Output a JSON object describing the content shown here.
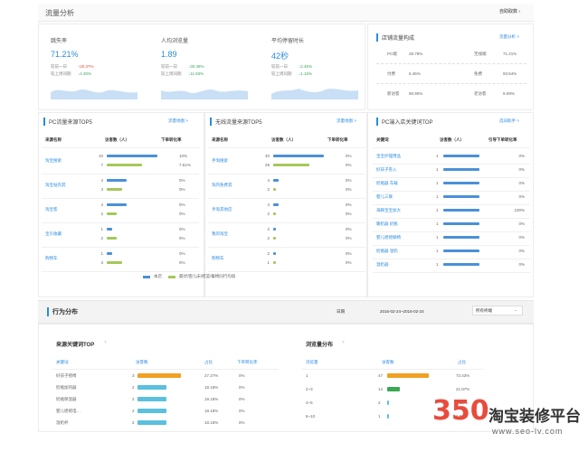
{
  "header": {
    "title": "流量分析",
    "button": "自助取数"
  },
  "metrics": [
    {
      "label": "跳失率",
      "value": "71.21%",
      "cmp1_label": "较前一日",
      "cmp1_val": "↑20.37%",
      "cmp2_label": "较上周同期",
      "cmp2_val": "↓4.30%",
      "c1": "up",
      "c2": "down"
    },
    {
      "label": "人均浏览量",
      "value": "1.89",
      "cmp1_label": "较前一日",
      "cmp1_val": "↓30.48%",
      "cmp2_label": "较上周同期",
      "cmp2_val": "↓11.93%",
      "c1": "down",
      "c2": "down"
    },
    {
      "label": "平均停留时长",
      "value": "42秒",
      "cmp1_label": "较前一日",
      "cmp1_val": "↓2.45%",
      "cmp2_label": "较上周同期",
      "cmp2_val": "↓1.16%",
      "c1": "down",
      "c2": "down"
    }
  ],
  "composition": {
    "title": "店铺流量构成",
    "link": "流量分析 >",
    "rows": [
      {
        "a_label": "PC端",
        "a_val": "28.78%",
        "b_label": "无线端",
        "b_val": "71.21%"
      },
      {
        "a_label": "付费",
        "a_val": "6.45%",
        "b_label": "免费",
        "b_val": "93.54%"
      },
      {
        "a_label": "新访客",
        "a_val": "90.90%",
        "b_label": "老访客",
        "b_val": "9.09%"
      }
    ]
  },
  "pc_source": {
    "title": "PC流量来源TOP5",
    "link": "流量地图 >",
    "headers": [
      "来源名称",
      "访客数（人）",
      "下单转化率"
    ],
    "rows": [
      {
        "name": "淘宝搜索",
        "v1": "10",
        "v2": "7",
        "r1": "10%",
        "r2": "7.51%",
        "b1": 1.0,
        "b2": 0.7
      },
      {
        "name": "淘宝站内其",
        "v1": "4",
        "v2": "3",
        "r1": "0%",
        "r2": "0%",
        "b1": 0.4,
        "b2": 0.3
      },
      {
        "name": "淘宝客",
        "v1": "4",
        "v2": "2",
        "r1": "0%",
        "r2": "0%",
        "b1": 0.4,
        "b2": 0.2
      },
      {
        "name": "宝贝收藏",
        "v1": "1",
        "v2": "2",
        "r1": "0%",
        "r2": "0%",
        "b1": 0.1,
        "b2": 0.2
      },
      {
        "name": "购物车",
        "v1": "1",
        "v2": "3",
        "r1": "0%",
        "r2": "0%",
        "b1": 0.1,
        "b2": 0.3
      }
    ]
  },
  "wireless_source": {
    "title": "无线流量来源TOP5",
    "link": "流量地图 >",
    "headers": [
      "来源名称",
      "访客数（人）",
      "下单转化率"
    ],
    "rows": [
      {
        "name": "手淘搜索",
        "v1": "40",
        "v2": "29",
        "r1": "0%",
        "r2": "0%",
        "b1": 1.0,
        "b2": 0.72
      },
      {
        "name": "淘内免费其",
        "v1": "4",
        "v2": "2",
        "r1": "0%",
        "r2": "0%",
        "b1": 0.1,
        "b2": 0.05
      },
      {
        "name": "手淘其他店",
        "v1": "4",
        "v2": "2",
        "r1": "0%",
        "r2": "0%",
        "b1": 0.1,
        "b2": 0.05
      },
      {
        "name": "我的淘宝",
        "v1": "2",
        "v2": "2",
        "r1": "0%",
        "r2": "0%",
        "b1": 0.05,
        "b2": 0.05
      },
      {
        "name": "购物车",
        "v1": "2",
        "v2": "1",
        "r1": "0%",
        "r2": "0%",
        "b1": 0.05,
        "b2": 0.03
      }
    ]
  },
  "legend": {
    "a": "本店",
    "b": "最伏/婴儿床/摇篮/餐椅同行均值"
  },
  "keywords": {
    "title": "PC端入店关键词TOP",
    "link": "选词助手 >",
    "headers": [
      "关键词",
      "访客数（人）",
      "引导下单转化率"
    ],
    "rows": [
      {
        "name": "宝宝护理用品",
        "v": "1",
        "r": "0%"
      },
      {
        "name": "好孩子卷入",
        "v": "1",
        "r": "0%"
      },
      {
        "name": "奶瓶器 车载",
        "v": "1",
        "r": "0%"
      },
      {
        "name": "婴儿三联",
        "v": "1",
        "r": "0%"
      },
      {
        "name": "海豚宝宝加大",
        "v": "1",
        "r": "100%"
      },
      {
        "name": "暖奶器 奶瓶",
        "v": "1",
        "r": "0%"
      },
      {
        "name": "婴儿摇摇躺椅",
        "v": "1",
        "r": "0%"
      },
      {
        "name": "奶瓶器 温奶",
        "v": "1",
        "r": "0%"
      },
      {
        "name": "温奶器",
        "v": "1",
        "r": "0%"
      }
    ]
  },
  "behavior": {
    "title": "行为分布",
    "date_label": "日期",
    "date_range": "2016-02-24~2016-02-24",
    "terminal": "所有终端",
    "kw_section": {
      "title": "来源关键词TOP",
      "headers": [
        "关键词",
        "访客数",
        "占比",
        "下单转化率"
      ],
      "rows": [
        {
          "name": "好孩子摇椅",
          "v": "3",
          "pct": "27.27%",
          "r": "0%",
          "frac": 1.0,
          "color": "#f0a023"
        },
        {
          "name": "奶瓶加热器",
          "v": "2",
          "pct": "18.18%",
          "r": "0%",
          "frac": 0.67,
          "color": "#5bc0de"
        },
        {
          "name": "奶瓶保温器",
          "v": "2",
          "pct": "18.18%",
          "r": "0%",
          "frac": 0.67,
          "color": "#5bc0de"
        },
        {
          "name": "婴儿摇摇电…",
          "v": "2",
          "pct": "18.18%",
          "r": "0%",
          "frac": 0.67,
          "color": "#5bc0de"
        },
        {
          "name": "温奶杯",
          "v": "2",
          "pct": "18.18%",
          "r": "0%",
          "frac": 0.67,
          "color": "#5bc0de"
        }
      ]
    },
    "depth_section": {
      "title": "浏览量分布",
      "headers": [
        "浏览量",
        "访客数",
        "占比"
      ],
      "rows": [
        {
          "name": "1",
          "v": "47",
          "pct": "73.43%",
          "frac": 1.0,
          "color": "#f0a023"
        },
        {
          "name": "2~3",
          "v": "14",
          "pct": "21.87%",
          "frac": 0.3,
          "color": "#3aa856"
        },
        {
          "name": "4~5",
          "v": "2",
          "pct": "3.12%",
          "frac": 0.05,
          "color": "#5bc0de"
        },
        {
          "name": "6~10",
          "v": "1",
          "pct": "1.56%",
          "frac": 0.03,
          "color": "#5bc0de"
        }
      ]
    }
  },
  "watermark": {
    "brand": "淘宝装修平台",
    "url": "www.seo-lv.com",
    "logo": "350"
  },
  "colors": {
    "accent": "#2b8be0",
    "shop_bar": "#4a90d9",
    "peer_bar": "#a5c85a"
  }
}
